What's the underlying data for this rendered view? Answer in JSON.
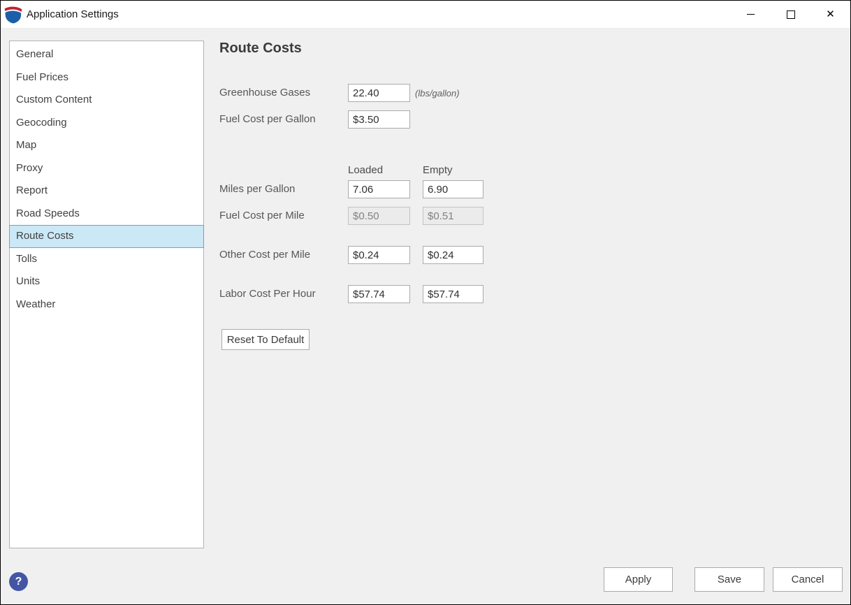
{
  "window": {
    "title": "Application Settings",
    "icons": {
      "minimize": "minimize-icon",
      "maximize": "maximize-icon",
      "close_glyph": "✕",
      "logo": "route-shield-logo"
    }
  },
  "sidebar": {
    "items": [
      {
        "label": "General",
        "selected": false
      },
      {
        "label": "Fuel Prices",
        "selected": false
      },
      {
        "label": "Custom Content",
        "selected": false
      },
      {
        "label": "Geocoding",
        "selected": false
      },
      {
        "label": "Map",
        "selected": false
      },
      {
        "label": "Proxy",
        "selected": false
      },
      {
        "label": "Report",
        "selected": false
      },
      {
        "label": "Road Speeds",
        "selected": false
      },
      {
        "label": "Route Costs",
        "selected": true
      },
      {
        "label": "Tolls",
        "selected": false
      },
      {
        "label": "Units",
        "selected": false
      },
      {
        "label": "Weather",
        "selected": false
      }
    ]
  },
  "content": {
    "heading": "Route Costs",
    "single_fields": [
      {
        "label": "Greenhouse Gases",
        "value": "22.40",
        "note": "(lbs/gallon)",
        "disabled": false
      },
      {
        "label": "Fuel Cost per Gallon",
        "value": "$3.50",
        "note": "",
        "disabled": false
      }
    ],
    "columns": {
      "loaded": "Loaded",
      "empty": "Empty"
    },
    "pair_fields": [
      {
        "label": "Miles per Gallon",
        "loaded": "7.06",
        "empty": "6.90",
        "disabled": false
      },
      {
        "label": "Fuel Cost per Mile",
        "loaded": "$0.50",
        "empty": "$0.51",
        "disabled": true
      },
      {
        "label": "Other Cost per Mile",
        "loaded": "$0.24",
        "empty": "$0.24",
        "disabled": false
      },
      {
        "label": "Labor Cost Per Hour",
        "loaded": "$57.74",
        "empty": "$57.74",
        "disabled": false
      }
    ],
    "reset_label": "Reset To Default"
  },
  "footer": {
    "help_glyph": "?",
    "apply_label": "Apply",
    "save_label": "Save",
    "cancel_label": "Cancel"
  },
  "colors": {
    "selection_bg": "#cbe8f6",
    "selection_border": "#54aada",
    "help_bg": "#4355a4",
    "logo_red": "#c3202f",
    "logo_blue": "#1d5ea8",
    "window_bg": "#f0f0f0"
  }
}
